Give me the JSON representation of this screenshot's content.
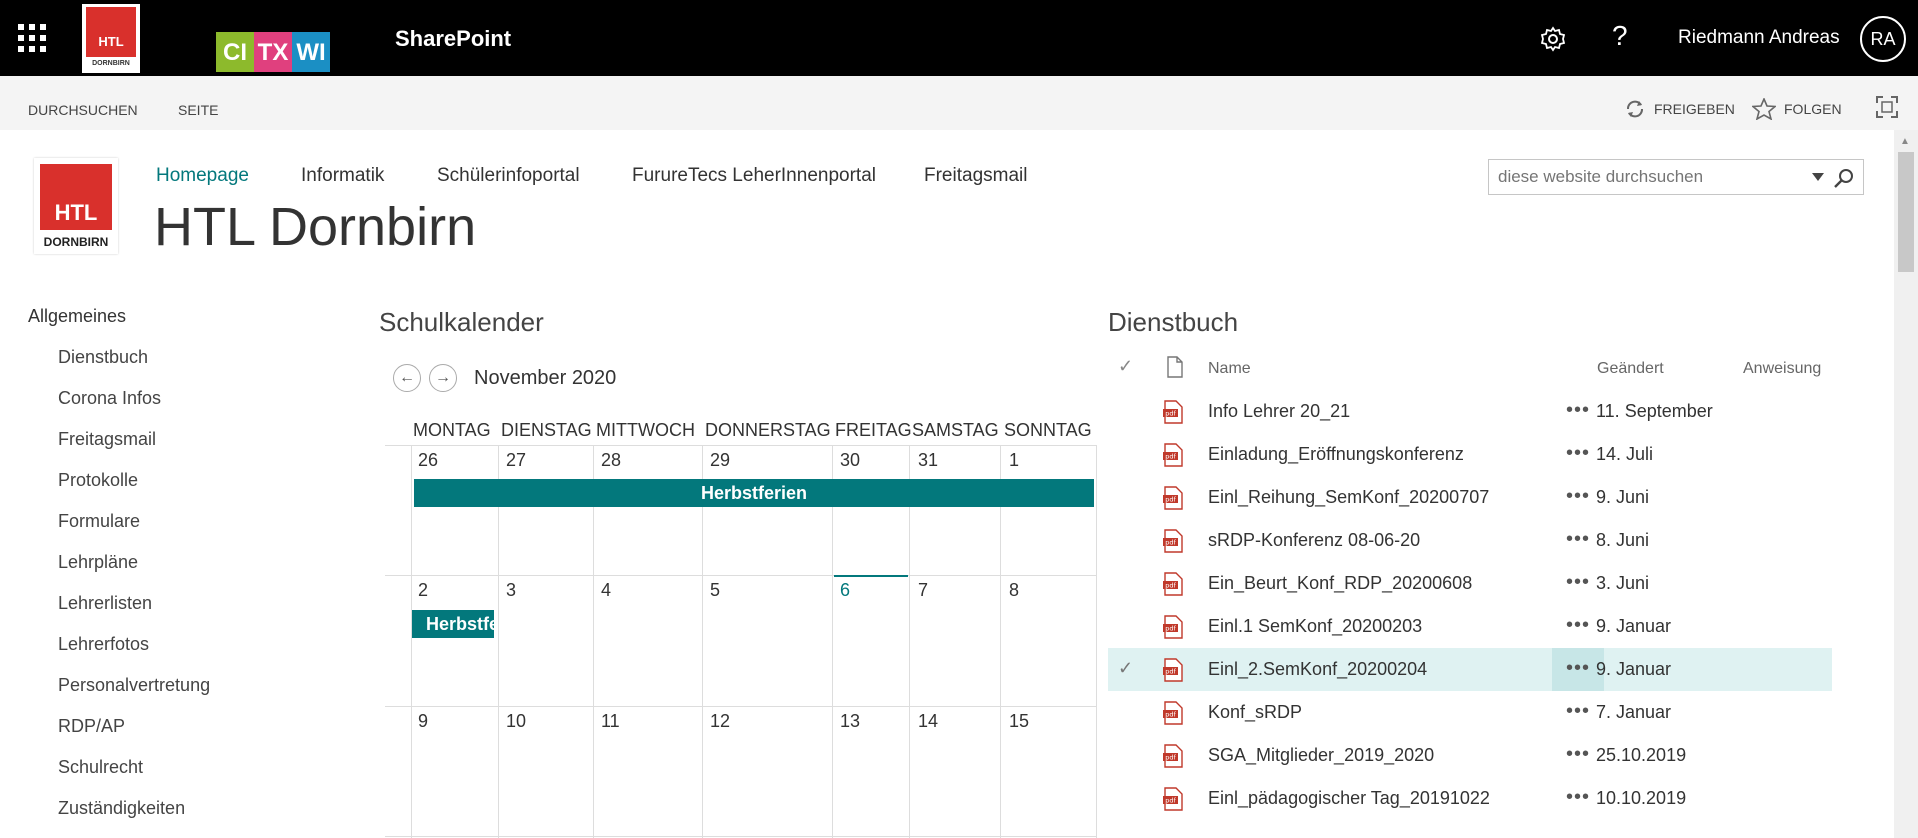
{
  "suite": {
    "app_title": "SharePoint",
    "user_name": "Riedmann Andreas",
    "user_initials": "RA",
    "logo_top": "HTL",
    "logo_sub": "DORNBIRN",
    "brand_letters": [
      {
        "text": "CI",
        "color": "#8dba2c"
      },
      {
        "text": "TX",
        "color": "#e0407e"
      },
      {
        "text": "WI",
        "color": "#1b8fc4"
      }
    ]
  },
  "ribbon": {
    "tabs": [
      "DURCHSUCHEN",
      "SEITE"
    ],
    "share_label": "FREIGEBEN",
    "follow_label": "FOLGEN"
  },
  "site": {
    "logo_top": "HTL",
    "logo_sub": "DORNBIRN",
    "title": "HTL Dornbirn",
    "nav": [
      "Homepage",
      "Informatik",
      "Schülerinfoportal",
      "FurureTecs LeherInnenportal",
      "Freitagsmail"
    ],
    "search_placeholder": "diese website durchsuchen"
  },
  "left_nav": {
    "heading": "Allgemeines",
    "items": [
      "Dienstbuch",
      "Corona Infos",
      "Freitagsmail",
      "Protokolle",
      "Formulare",
      "Lehrpläne",
      "Lehrerlisten",
      "Lehrerfotos",
      "Personalvertretung",
      "RDP/AP",
      "Schulrecht",
      "Zuständigkeiten"
    ]
  },
  "calendar": {
    "title": "Schulkalender",
    "month": "November 2020",
    "day_headers": [
      "MONTAG",
      "DIENSTAG",
      "MITTWOCH",
      "DONNERSTAG",
      "FREITAG",
      "SAMSTAG",
      "SONNTAG"
    ],
    "weeks": [
      [
        "26",
        "27",
        "28",
        "29",
        "30",
        "31",
        "1"
      ],
      [
        "2",
        "3",
        "4",
        "5",
        "6",
        "7",
        "8"
      ],
      [
        "9",
        "10",
        "11",
        "12",
        "13",
        "14",
        "15"
      ]
    ],
    "today": "6",
    "event_week1": "Herbstferien",
    "event_week2": "Herbstferien"
  },
  "dienstbuch": {
    "title": "Dienstbuch",
    "columns": {
      "name": "Name",
      "changed": "Geändert",
      "assignment": "Anweisung"
    },
    "rows": [
      {
        "name": "Info Lehrer 20_21",
        "date": "11. September"
      },
      {
        "name": "Einladung_Eröffnungskonferenz",
        "date": "14. Juli"
      },
      {
        "name": "Einl_Reihung_SemKonf_20200707",
        "date": "9. Juni"
      },
      {
        "name": "sRDP-Konferenz 08-06-20",
        "date": "8. Juni"
      },
      {
        "name": "Ein_Beurt_Konf_RDP_20200608",
        "date": "3. Juni"
      },
      {
        "name": "Einl.1 SemKonf_20200203",
        "date": "9. Januar"
      },
      {
        "name": "Einl_2.SemKonf_20200204",
        "date": "9. Januar",
        "selected": true
      },
      {
        "name": "Konf_sRDP",
        "date": "7. Januar"
      },
      {
        "name": "SGA_Mitglieder_2019_2020",
        "date": "25.10.2019"
      },
      {
        "name": "Einl_pädagogischer Tag_20191022",
        "date": "10.10.2019"
      }
    ],
    "ellipsis": "•••"
  },
  "colors": {
    "accent": "#03787c",
    "brand_red": "#d9302c",
    "selected_row": "#dff2f2"
  }
}
